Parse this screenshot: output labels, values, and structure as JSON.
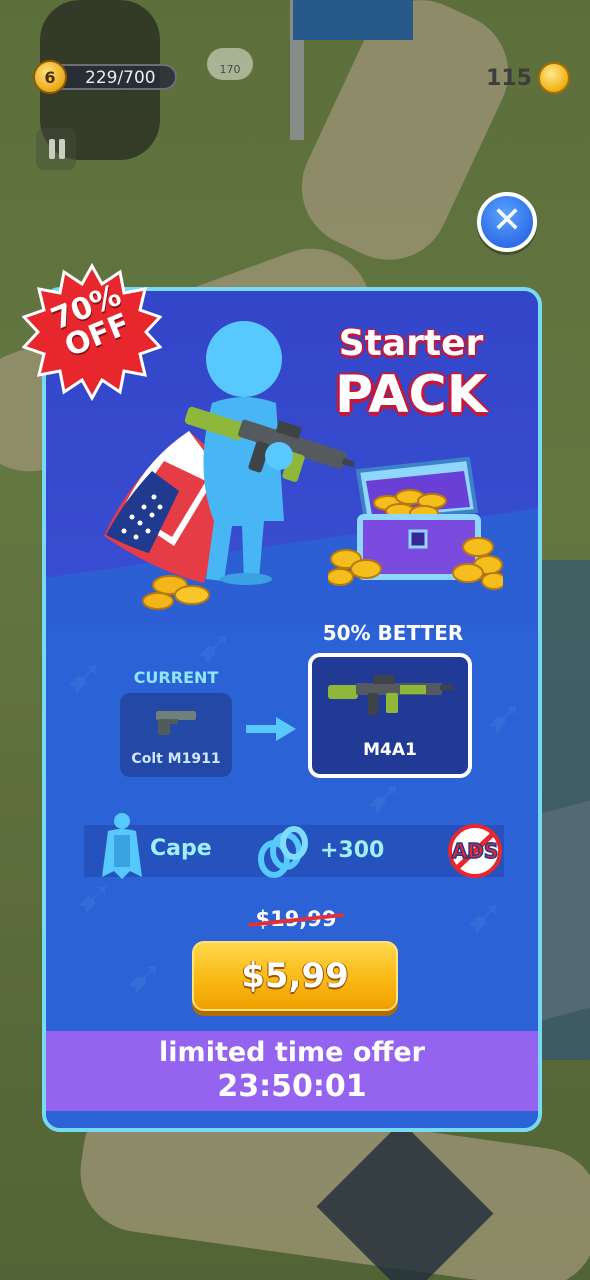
{
  "hud": {
    "level": "6",
    "xp": "229/700",
    "coins": "115",
    "upgrade_cost": "170"
  },
  "offer": {
    "discount_pct": "70%",
    "discount_off": "OFF",
    "title_line1": "Starter",
    "title_line2": "PACK",
    "better_label": "50% BETTER",
    "current_label": "CURRENT",
    "current_weapon": "Colt M1911",
    "new_weapon": "M4A1",
    "reward_cape": "Cape",
    "reward_coins": "+300",
    "ads_label": "ADS",
    "price_old": "$19,99",
    "price_new": "$5,99",
    "timer_title": "limited time offer",
    "timer_value": "23:50:01"
  },
  "colors": {
    "panel": "#2f45b8",
    "panel_border": "#77d9f2",
    "accent_cyan": "#9ff0ff",
    "buy_button": "#f9b915",
    "timer_bar": "#9464f0",
    "burst_red": "#e8262e"
  }
}
